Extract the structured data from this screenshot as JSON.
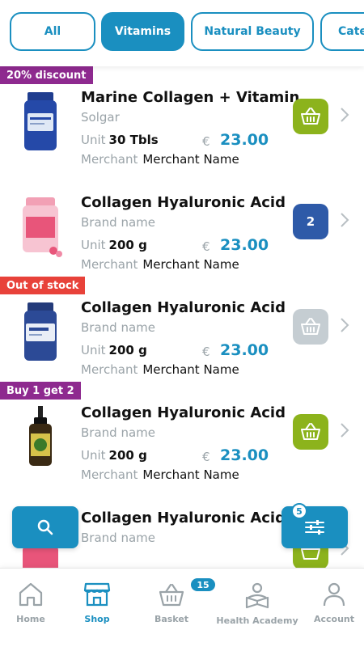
{
  "filters": [
    {
      "label": "All",
      "active": false
    },
    {
      "label": "Vitamins",
      "active": true
    },
    {
      "label": "Natural Beauty",
      "active": false
    },
    {
      "label": "Categ",
      "active": false
    }
  ],
  "products": [
    {
      "badge": "20% discount",
      "badge_color": "#8e2a8f",
      "name": "Marine Collagen + Vitamin",
      "brand": "Solgar",
      "unit_label": "Unit",
      "unit": "30 Tbls",
      "currency": "€",
      "price": "23.00",
      "merchant_label": "Merchant",
      "merchant": "Merchant Name",
      "cart": "basket",
      "cart_color": "#8cb31c"
    },
    {
      "badge": "",
      "badge_color": "",
      "name": "Collagen Hyaluronic Acid",
      "brand": "Brand name",
      "unit_label": "Unit",
      "unit": "200 g",
      "currency": "€",
      "price": "23.00",
      "merchant_label": "Merchant",
      "merchant": "Merchant Name",
      "cart": "count",
      "cart_count": "2",
      "cart_color": "#2e5aa8"
    },
    {
      "badge": "Out of stock",
      "badge_color": "#e8423a",
      "name": "Collagen Hyaluronic Acid",
      "brand": "Brand name",
      "unit_label": "Unit",
      "unit": "200 g",
      "currency": "€",
      "price": "23.00",
      "merchant_label": "Merchant",
      "merchant": "Merchant Name",
      "cart": "basket",
      "cart_color": "#c5cdd2"
    },
    {
      "badge": "Buy 1 get 2",
      "badge_color": "#8e2a8f",
      "name": "Collagen Hyaluronic Acid",
      "brand": "Brand name",
      "unit_label": "Unit",
      "unit": "200 g",
      "currency": "€",
      "price": "23.00",
      "merchant_label": "Merchant",
      "merchant": "Merchant Name",
      "cart": "basket",
      "cart_color": "#8cb31c"
    },
    {
      "badge": "",
      "badge_color": "",
      "name": "Collagen Hyaluronic Acid",
      "brand": "Brand name",
      "unit_label": "Unit",
      "unit": "",
      "currency": "",
      "price": "",
      "merchant_label": "",
      "merchant": "",
      "cart": "basket",
      "cart_color": "#8cb31c"
    }
  ],
  "fab": {
    "search_icon": "search-icon",
    "filter_icon": "sliders-icon",
    "filter_count": "5"
  },
  "nav": {
    "home": "Home",
    "shop": "Shop",
    "basket": "Basket",
    "basket_count": "15",
    "academy": "Health Academy",
    "account": "Account"
  },
  "colors": {
    "accent": "#1a8fc0",
    "muted": "#9aa3a8"
  }
}
